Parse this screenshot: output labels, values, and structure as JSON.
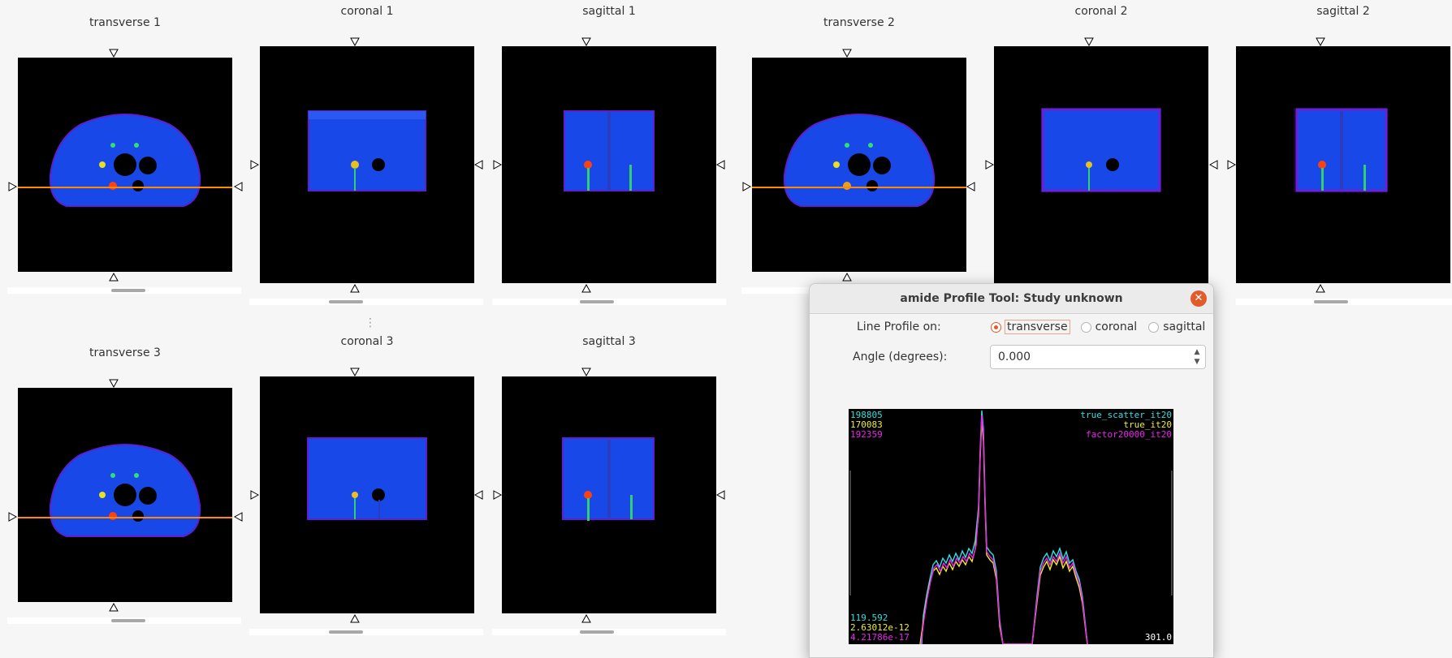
{
  "views": {
    "transverse1": "transverse 1",
    "coronal1": "coronal 1",
    "sagittal1": "sagittal 1",
    "transverse2": "transverse 2",
    "coronal2": "coronal 2",
    "sagittal2": "sagittal 2",
    "transverse3": "transverse 3",
    "coronal3": "coronal 3",
    "sagittal3": "sagittal 3"
  },
  "dialog": {
    "title": "amide Profile Tool: Study unknown",
    "close_icon": "close-icon",
    "line_profile_label": "Line Profile on:",
    "options": [
      "transverse",
      "coronal",
      "sagittal"
    ],
    "selected_option": "transverse",
    "angle_label": "Angle (degrees):",
    "angle_value": "0.000",
    "plot": {
      "max_values": [
        "198805",
        "170083",
        "192359"
      ],
      "min_values": [
        "119.592",
        "2.63012e-12",
        "4.21786e-17"
      ],
      "series": [
        "true_scatter_it20",
        "true_it20",
        "factor20000_it20"
      ],
      "series_colors": [
        "#30e0e0",
        "#f0f020",
        "#f020f0"
      ],
      "x_readout": "301.0"
    }
  },
  "colors": {
    "line_marker": "#ff8a00",
    "phantom_blue": "#1a4cff",
    "dialog_accent": "#e25b2b"
  }
}
